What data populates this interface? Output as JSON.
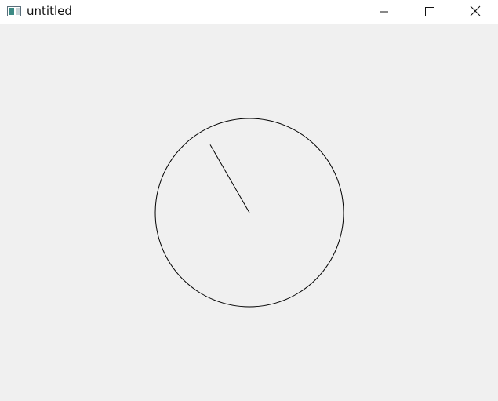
{
  "window": {
    "title": "untitled",
    "icon": "window-app-icon",
    "controls": {
      "minimize_icon": "minimize-icon",
      "maximize_icon": "maximize-icon",
      "close_icon": "close-icon"
    }
  },
  "canvas": {
    "background": "#f0f0f0",
    "dial": {
      "stroke": "#000000"
    },
    "hand": {
      "angle_deg": -30,
      "stroke": "#000000"
    }
  }
}
